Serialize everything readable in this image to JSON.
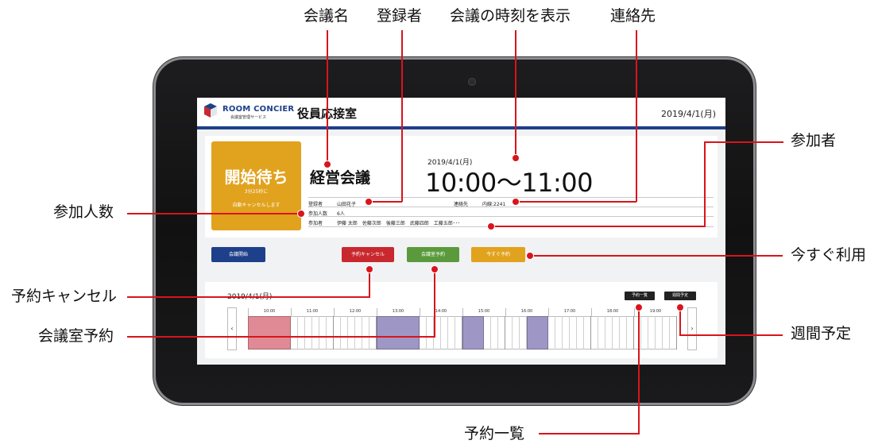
{
  "callouts": {
    "meeting_name": "会議名",
    "registrant": "登録者",
    "time_display": "会議の時刻を表示",
    "contact": "連絡先",
    "participants": "参加者",
    "participant_count": "参加人数",
    "use_now": "今すぐ利用",
    "reservation_cancel": "予約キャンセル",
    "room_reservation": "会議室予約",
    "weekly_schedule": "週間予定",
    "reservation_list": "予約一覧"
  },
  "header": {
    "logo_text": "ROOM CONCIER",
    "logo_subtext": "会議室管理サービス",
    "room_name": "役員応接室",
    "date": "2019/4/1(月)"
  },
  "status": {
    "title": "開始待ち",
    "countdown": "3分25秒に",
    "auto_cancel": "自動キャンセルします",
    "color": "#e1a21d"
  },
  "meeting": {
    "name": "経営会議",
    "date": "2019/4/1(月)",
    "time": "10:00〜11:00",
    "registrant_label": "登録者",
    "registrant": "山田花子",
    "contact_label": "連絡先",
    "contact": "内線:2241",
    "count_label": "参加人数",
    "count": "6人",
    "participants_label": "参加者",
    "participants": "伊藤 太郎　佐藤次郎　後藤三郎　武藤四郎　工藤五郎･･･"
  },
  "buttons": {
    "start": "会議開始",
    "cancel": "予約キャンセル",
    "reserve": "会議室予約",
    "reserve_now": "今すぐ予約"
  },
  "colors": {
    "start": "#1e3f8a",
    "cancel": "#c8282e",
    "reserve": "#5a9a3c",
    "reserve_now": "#e1a21d",
    "accent": "#d9141b"
  },
  "calendar": {
    "date": "2019/4/1(月)",
    "list_button": "予約一覧",
    "weekly_button": "週間予定",
    "prev_icon": "chevron-left-icon",
    "next_icon": "chevron-right-icon",
    "hours": [
      "10:00",
      "11:00",
      "12:00",
      "13:00",
      "14:00",
      "15:00",
      "16:00",
      "17:00",
      "18:00",
      "19:00"
    ],
    "bookings": [
      {
        "start": "10:00",
        "end": "11:00",
        "color": "#e08a95"
      },
      {
        "start": "13:00",
        "end": "14:00",
        "color": "#9e97c6"
      },
      {
        "start": "15:00",
        "end": "15:30",
        "color": "#9e97c6"
      },
      {
        "start": "16:30",
        "end": "17:00",
        "color": "#9e97c6"
      }
    ]
  }
}
